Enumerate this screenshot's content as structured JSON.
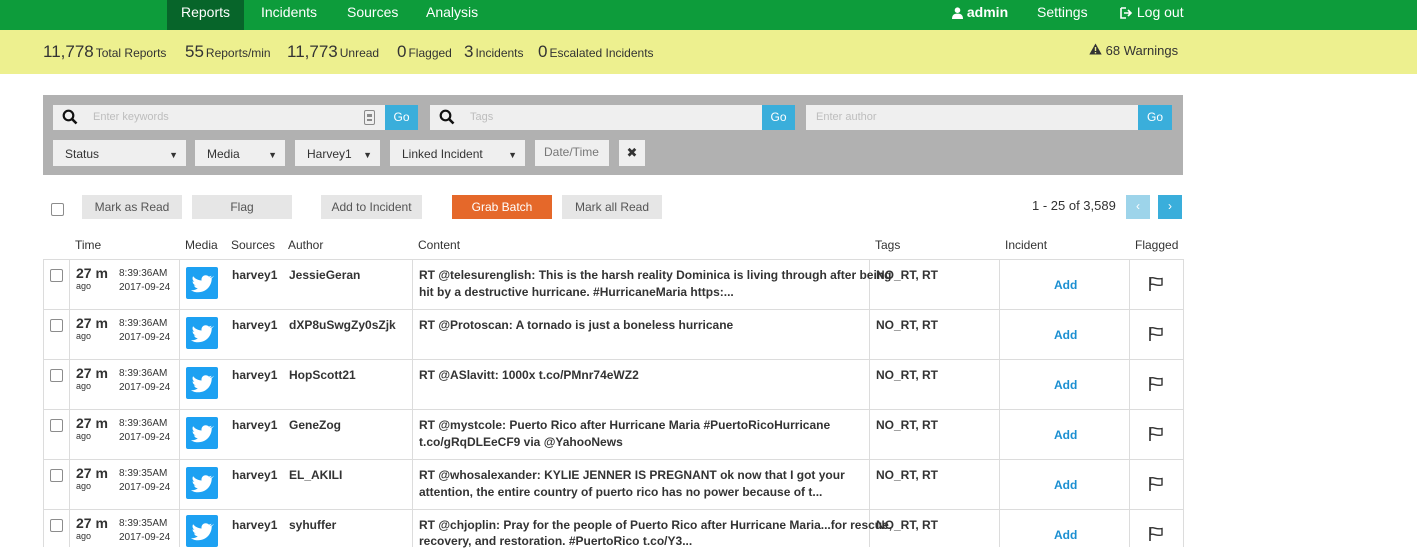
{
  "nav": {
    "items": [
      "Reports",
      "Incidents",
      "Sources",
      "Analysis"
    ],
    "user": "admin",
    "settings": "Settings",
    "logout": "Log out"
  },
  "stats": [
    {
      "num": "11,778",
      "label": "Total Reports"
    },
    {
      "num": "55",
      "label": "Reports/min"
    },
    {
      "num": "11,773",
      "label": "Unread"
    },
    {
      "num": "0",
      "label": "Flagged"
    },
    {
      "num": "3",
      "label": "Incidents"
    },
    {
      "num": "0",
      "label": "Escalated Incidents"
    }
  ],
  "warnings": "68 Warnings",
  "filters": {
    "keywords_placeholder": "Enter keywords",
    "tags_placeholder": "Tags",
    "author_placeholder": "Enter author",
    "go": "Go",
    "status": "Status",
    "media": "Media",
    "source": "Harvey1",
    "linked_incident": "Linked Incident",
    "datetime": "Date/Time",
    "clear": "✖"
  },
  "actions": {
    "mark_read": "Mark as Read",
    "flag": "Flag",
    "add_incident": "Add to Incident",
    "grab_batch": "Grab Batch",
    "mark_all_read": "Mark all Read"
  },
  "pagination": {
    "text": "1 - 25 of 3,589",
    "prev": "‹",
    "next": "›"
  },
  "columns": [
    "Time",
    "Media",
    "Sources",
    "Author",
    "Content",
    "Tags",
    "Incident",
    "Flagged"
  ],
  "colors": {
    "nav": "#0d9c3b",
    "nav_active": "#07652a",
    "stats": "#edf08f",
    "accent": "#3aaedb",
    "orange": "#e5682a",
    "twitter": "#1da1f2"
  },
  "rows": [
    {
      "ago": "27 m",
      "ago_label": "ago",
      "time": "8:39:36AM",
      "date": "2017-09-24",
      "media": "twitter-icon",
      "source": "harvey1",
      "author": "JessieGeran",
      "content1": "RT @telesurenglish: This is the harsh reality Dominica is living through after being",
      "content2": "hit by a destructive hurricane. #HurricaneMaria https:...",
      "tags": "NO_RT, RT",
      "incident": "Add"
    },
    {
      "ago": "27 m",
      "ago_label": "ago",
      "time": "8:39:36AM",
      "date": "2017-09-24",
      "media": "twitter-icon",
      "source": "harvey1",
      "author": "dXP8uSwgZy0sZjk",
      "content1": "RT @Protoscan: A tornado is just a boneless hurricane",
      "content2": "",
      "tags": "NO_RT, RT",
      "incident": "Add"
    },
    {
      "ago": "27 m",
      "ago_label": "ago",
      "time": "8:39:36AM",
      "date": "2017-09-24",
      "media": "twitter-icon",
      "source": "harvey1",
      "author": "HopScott21",
      "content1": "RT @ASlavitt: 1000x t.co/PMnr74eWZ2",
      "content2": "",
      "tags": "NO_RT, RT",
      "incident": "Add"
    },
    {
      "ago": "27 m",
      "ago_label": "ago",
      "time": "8:39:36AM",
      "date": "2017-09-24",
      "media": "twitter-icon",
      "source": "harvey1",
      "author": "GeneZog",
      "content1": "RT @mystcole: Puerto Rico after Hurricane Maria #PuertoRicoHurricane",
      "content2": "t.co/gRqDLEeCF9 via @YahooNews",
      "tags": "NO_RT, RT",
      "incident": "Add"
    },
    {
      "ago": "27 m",
      "ago_label": "ago",
      "time": "8:39:35AM",
      "date": "2017-09-24",
      "media": "twitter-icon",
      "source": "harvey1",
      "author": "EL_AKILI",
      "content1": "RT @whosalexander: KYLIE JENNER IS PREGNANT ok now that I got your",
      "content2": "attention, the entire country of puerto rico has no power because of t...",
      "tags": "NO_RT, RT",
      "incident": "Add"
    },
    {
      "ago": "27 m",
      "ago_label": "ago",
      "time": "8:39:35AM",
      "date": "2017-09-24",
      "media": "twitter-icon",
      "source": "harvey1",
      "author": "syhuffer",
      "content1": "RT @chjoplin: Pray for the people of Puerto Rico after Hurricane Maria...for rescue,",
      "content2": "recovery, and restoration. #PuertoRico t.co/Y3...",
      "tags": "NO_RT, RT",
      "incident": "Add"
    }
  ]
}
